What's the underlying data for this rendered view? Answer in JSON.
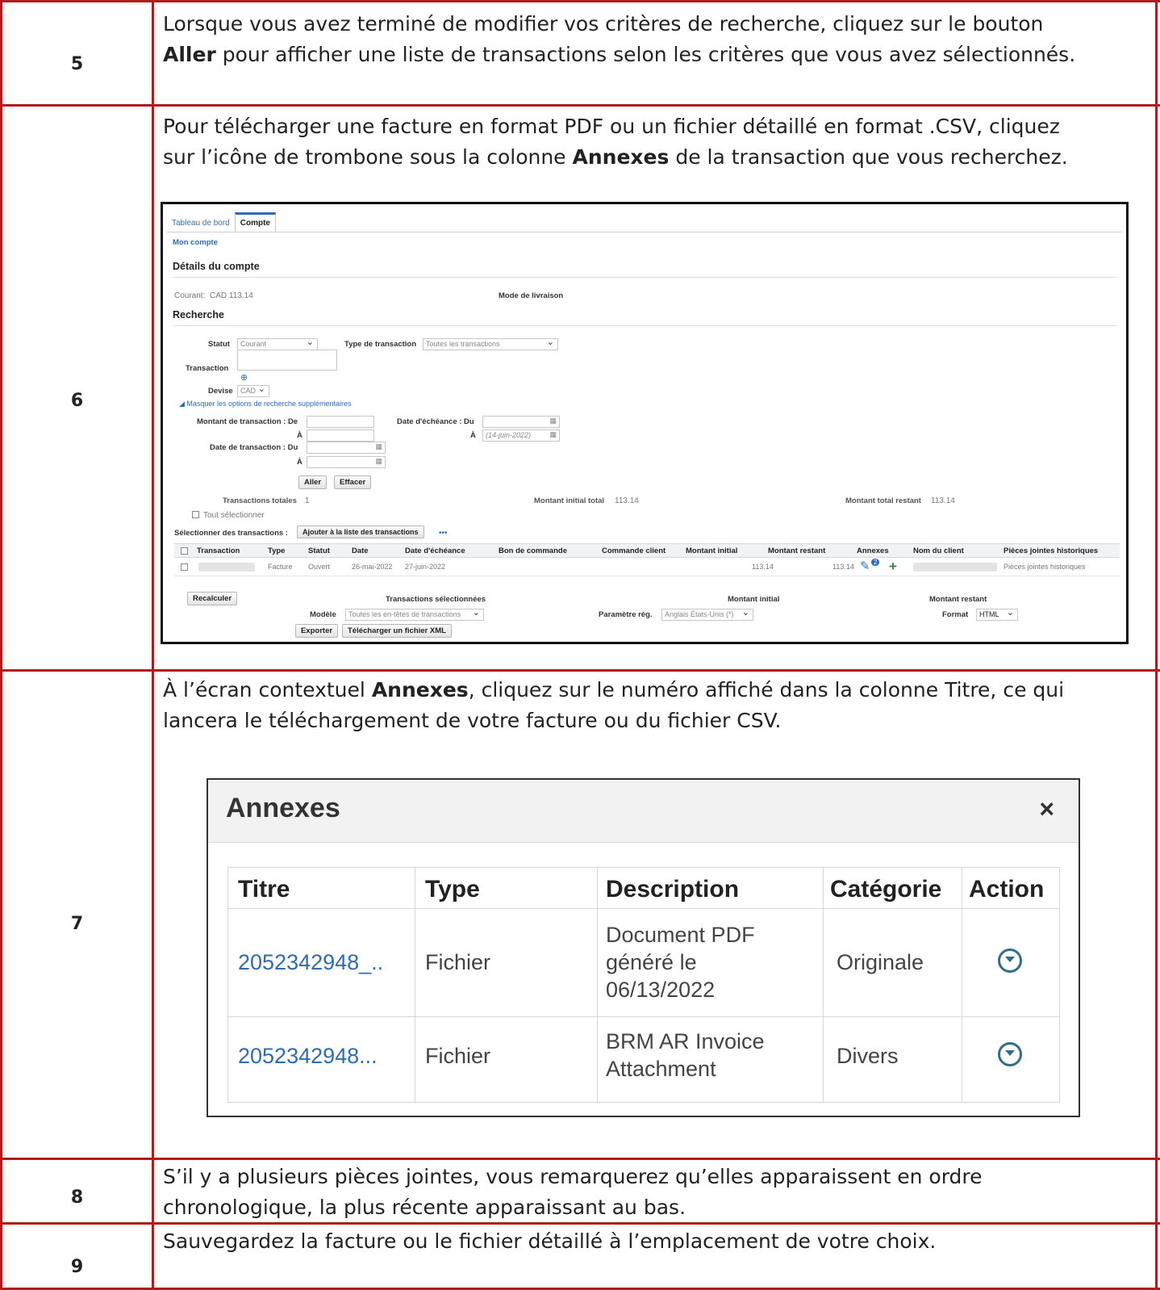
{
  "steps": [
    {
      "num": "5",
      "line1_pre": "Lorsque vous avez terminé de modifier vos critères de recherche, cliquez sur le bouton",
      "line2_bold": "Aller",
      "line2_post": " pour afficher une liste de transactions selon les critères que vous avez sélectionnés."
    },
    {
      "num": "6",
      "line1": "Pour télécharger une facture en format PDF ou un fichier détaillé en format .CSV, cliquez",
      "line2_pre": "sur l’icône de trombone sous la colonne ",
      "line2_bold": "Annexes",
      "line2_post": " de la transaction que vous recherchez."
    },
    {
      "num": "7",
      "line1_pre": "À l’écran contextuel ",
      "line1_bold": "Annexes",
      "line1_post": ", cliquez sur le numéro affiché dans la colonne Titre, ce qui",
      "line2": "lancera le téléchargement de votre facture ou du fichier CSV."
    },
    {
      "num": "8",
      "line1": "S’il y a plusieurs pièces jointes, vous remarquerez qu’elles apparaissent en ordre",
      "line2": "chronologique, la plus récente apparaissant au bas."
    },
    {
      "num": "9",
      "line1": "Sauvegardez la facture ou le fichier détaillé à l’emplacement de votre choix."
    }
  ],
  "account": {
    "tabs": [
      "Tableau de bord",
      "Compte"
    ],
    "breadcrumb": "Mon compte",
    "details_title": "Détails du compte",
    "current_label": "Courant:",
    "current_value": "CAD 113.14",
    "delivery_label": "Mode de livraison",
    "search_title": "Recherche",
    "status_label": "Statut",
    "status_value": "Courant",
    "txn_type_label": "Type de transaction",
    "txn_type_value": "Toutes les transactions",
    "transaction_label": "Transaction",
    "currency_label": "Devise",
    "currency_value": "CAD",
    "hide_options": "Masquer les options de recherche supplémentaires",
    "amount_from_label": "Montant de transaction : De",
    "to_label": "À",
    "due_date_label": "Date d'échéance : Du",
    "due_to_placeholder": "(14-juin-2022)",
    "txn_date_label": "Date de transaction : Du",
    "go_button": "Aller",
    "clear_button": "Effacer",
    "total_txn_label": "Transactions totales",
    "total_txn_value": "1",
    "initial_total_label": "Montant initial total",
    "initial_total_value": "113.14",
    "remaining_total_label": "Montant total restant",
    "remaining_total_value": "113.14",
    "select_all": "Tout sélectionner",
    "select_txn_label": "Sélectionner des transactions :",
    "add_to_list_button": "Ajouter à la liste des transactions",
    "more": "•••",
    "columns": [
      "Transaction",
      "Type",
      "Statut",
      "Date",
      "Date d'échéance",
      "Bon de commande",
      "Commande client",
      "Montant initial",
      "Montant restant",
      "Annexes",
      "Nom du client",
      "Pièces jointes historiques"
    ],
    "row": {
      "type": "Facture",
      "status": "Ouvert",
      "date": "26-mai-2022",
      "due": "27-juin-2022",
      "initial": "113.14",
      "remaining": "113.14",
      "attach_count": "2",
      "history_link": "Pièces jointes historiques"
    },
    "recalc_button": "Recalculer",
    "selected_txn_label": "Transactions sélectionnées",
    "initial_amount_label": "Montant initial",
    "remaining_amount_label": "Montant restant",
    "model_label": "Modèle",
    "model_value": "Toutes les en-têtes de transactions",
    "regional_label": "Paramètre rég.",
    "regional_value": "Anglais États-Unis (*)",
    "format_label": "Format",
    "format_value": "HTML",
    "export_button": "Exporter",
    "download_xml_button": "Télécharger un fichier XML"
  },
  "annexes": {
    "title": "Annexes",
    "close": "×",
    "headers": [
      "Titre",
      "Type",
      "Description",
      "Catégorie",
      "Action"
    ],
    "rows": [
      {
        "title": "2052342948_..",
        "type": "Fichier",
        "desc_lines": [
          "Document PDF",
          "généré le",
          "06/13/2022"
        ],
        "category": "Originale"
      },
      {
        "title": "2052342948...",
        "type": "Fichier",
        "desc_lines": [
          "BRM AR Invoice",
          "Attachment"
        ],
        "category": "Divers"
      }
    ]
  },
  "colors": {
    "border": "#b31b1b",
    "link": "#2d6bb5",
    "action_icon": "#2f6f86"
  }
}
